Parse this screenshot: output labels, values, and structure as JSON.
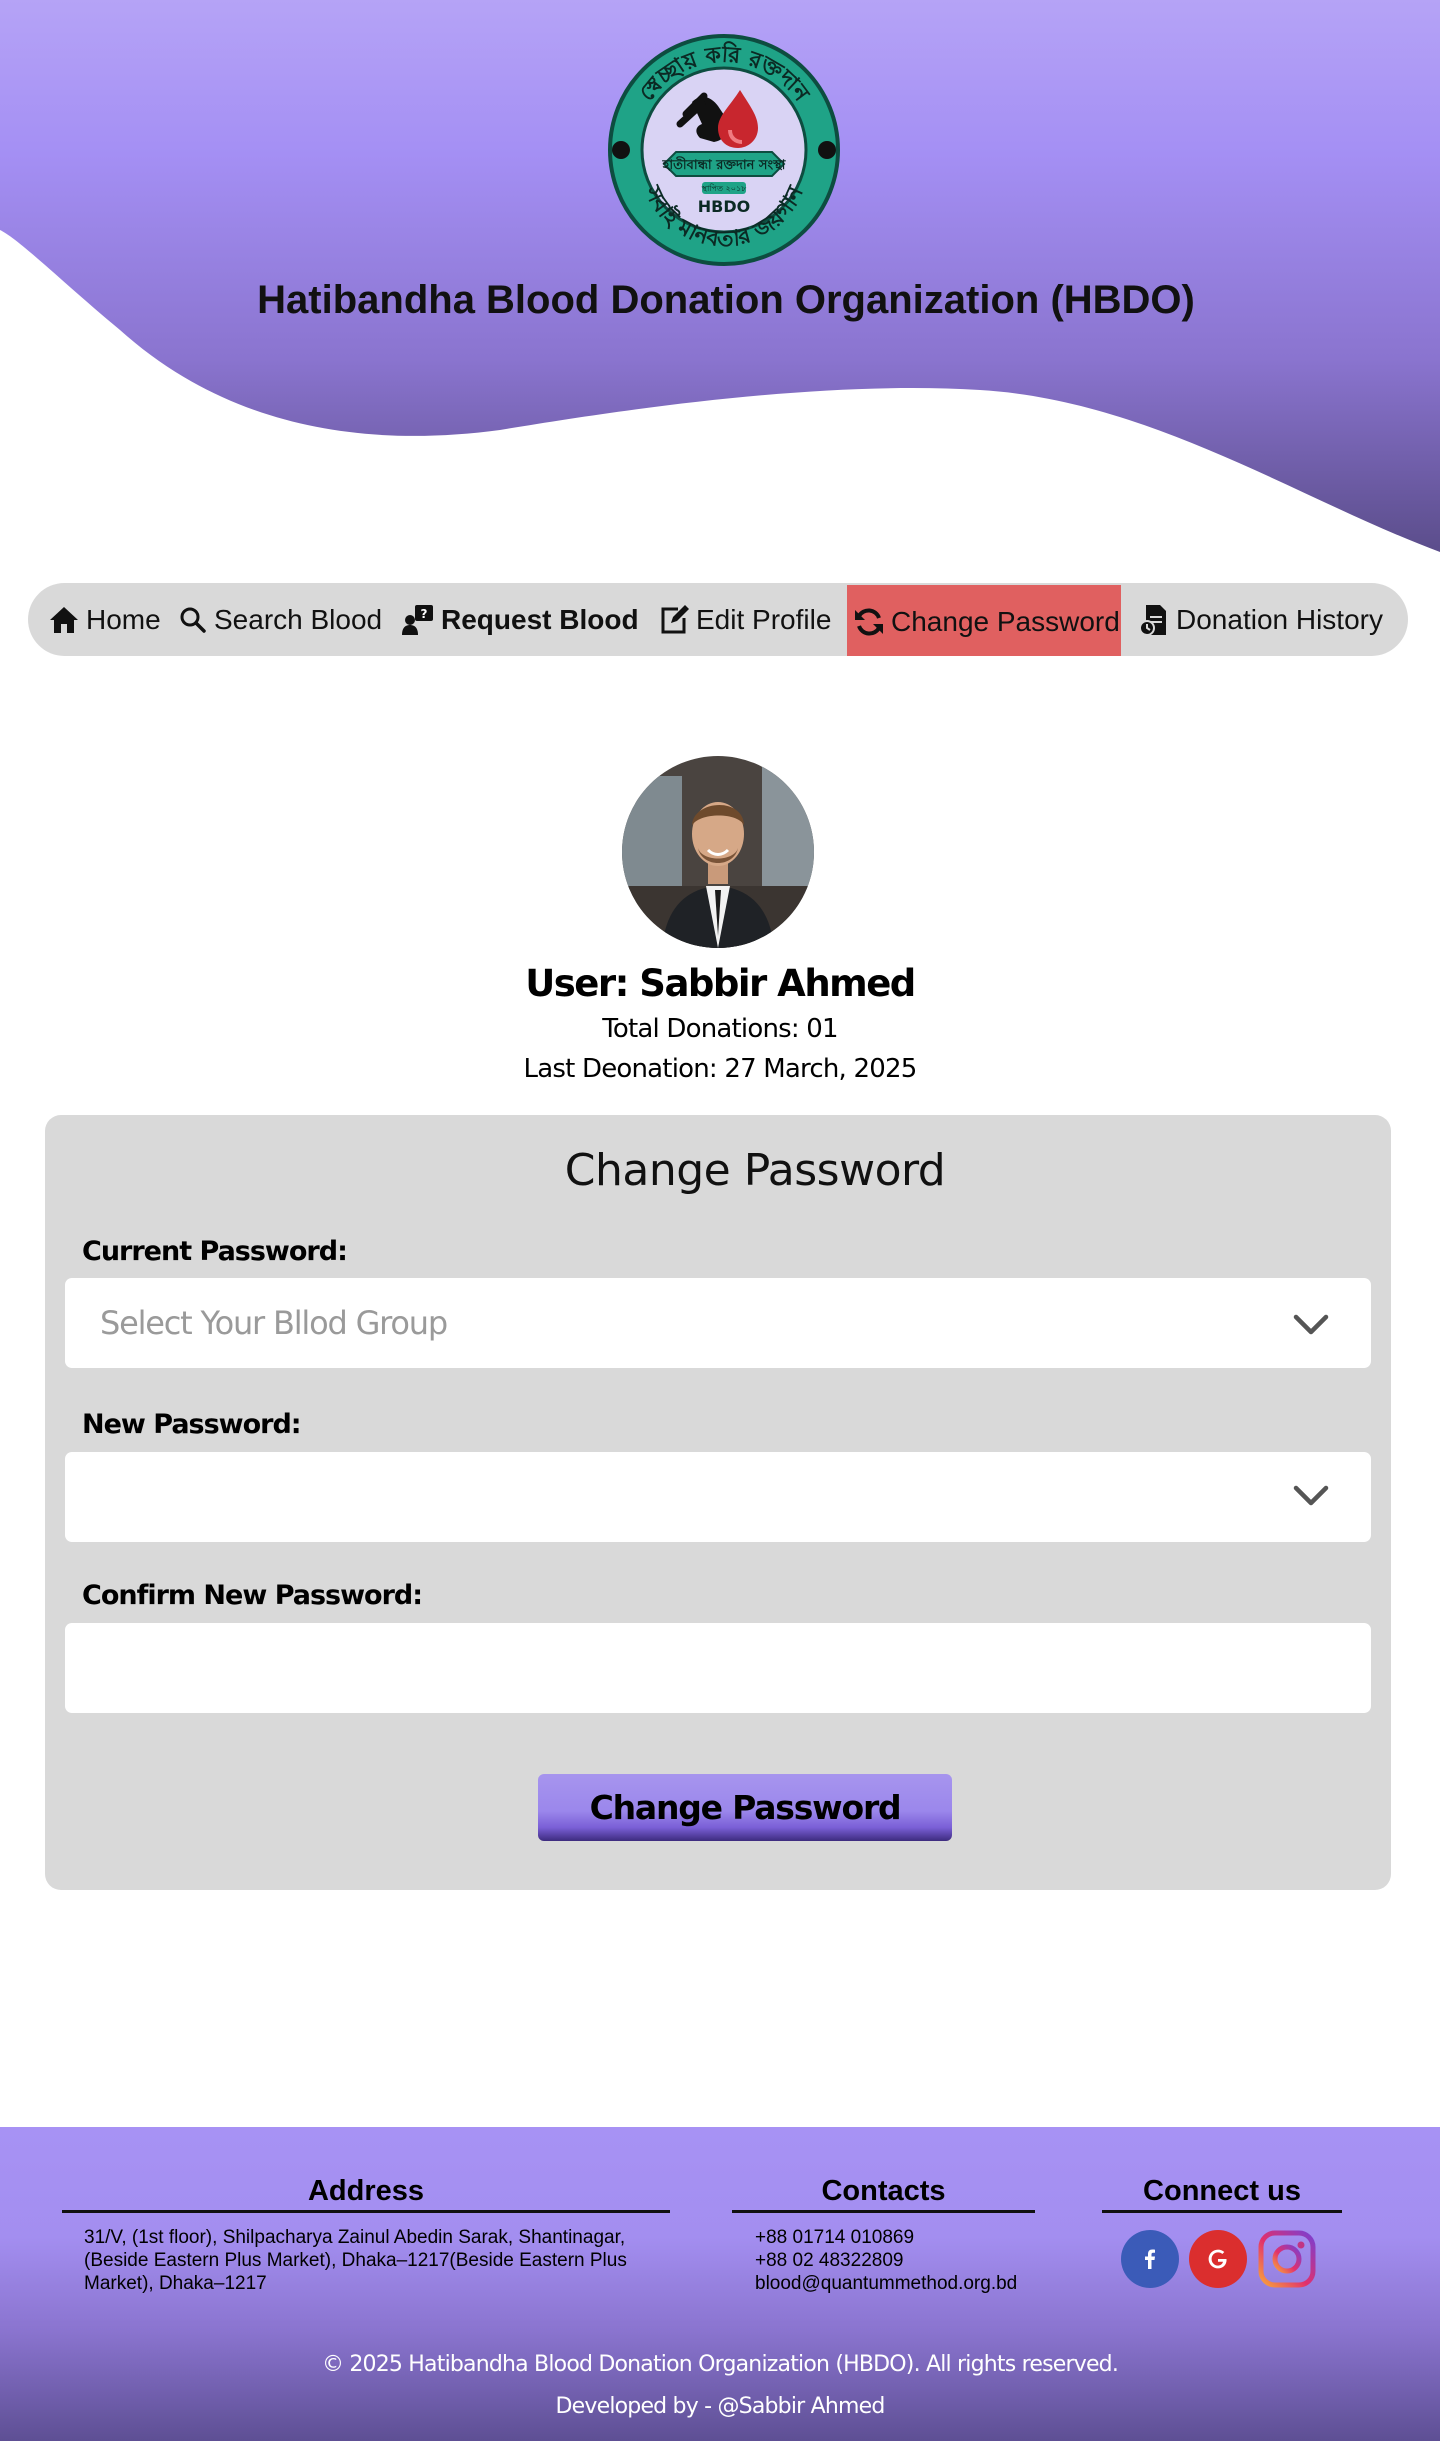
{
  "header": {
    "org_name": "Hatibandha Blood Donation Organization (HBDO)",
    "logo_text_top": "স্বেচ্ছায় করি রক্তদান",
    "logo_text_band": "হাতীবান্ধা রক্তদান সংস্থা",
    "logo_text_small": "স্থাপিত ২০১৮",
    "logo_text_acronym": "HBDO",
    "logo_text_bottom": "সবাই মানবতার জয়গান"
  },
  "nav": {
    "items": [
      {
        "label": "Home",
        "icon": "home-icon"
      },
      {
        "label": "Search Blood",
        "icon": "search-icon"
      },
      {
        "label": "Request Blood",
        "icon": "request-icon"
      },
      {
        "label": "Edit Profile",
        "icon": "edit-icon"
      },
      {
        "label": "Change Password",
        "icon": "refresh-icon",
        "active": true
      },
      {
        "label": "Donation History",
        "icon": "history-icon"
      }
    ]
  },
  "profile": {
    "user": "User: Sabbir Ahmed",
    "total_donations": "Total Donations: 01",
    "last_donation": "Last Deonation: 27 March, 2025"
  },
  "form": {
    "title": "Change Password",
    "current_label": "Current Password:",
    "current_placeholder": "Select Your Bllod Group",
    "new_label": "New Password:",
    "confirm_label": "Confirm New Password:",
    "submit_label": "Change Password"
  },
  "footer": {
    "address_heading": "Address",
    "address_lines": [
      "31/V, (1st floor), Shilpacharya Zainul Abedin Sarak, Shantinagar,",
      "(Beside Eastern Plus Market), Dhaka–1217(Beside Eastern Plus",
      "Market), Dhaka–1217"
    ],
    "contacts_heading": "Contacts",
    "contact_lines": [
      "+88 01714 010869",
      "+88 02 48322809",
      "blood@quantummethod.org.bd"
    ],
    "connect_heading": "Connect us",
    "social": [
      {
        "name": "facebook",
        "glyph": "f",
        "color": "#3b5bb8"
      },
      {
        "name": "google",
        "glyph": "G",
        "color": "#db2e2e"
      },
      {
        "name": "instagram",
        "color": "#c13584"
      }
    ],
    "copyright": "© 2025 Hatibandha Blood Donation Organization (HBDO). All rights reserved.",
    "developer": "Developed by - @Sabbir Ahmed"
  },
  "colors": {
    "header_purple": "#a48ff4",
    "nav_active": "#e06060",
    "panel_gray": "#d9d9d9",
    "logo_teal": "#1fa387"
  }
}
